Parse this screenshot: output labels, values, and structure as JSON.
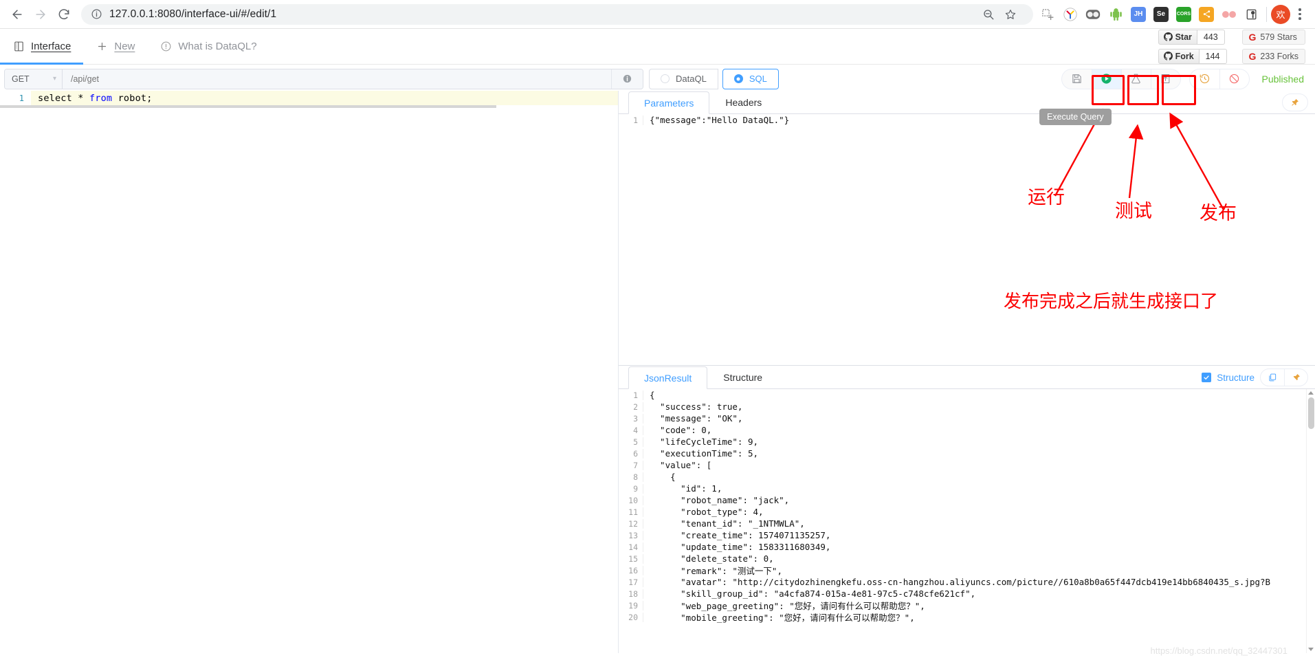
{
  "browser": {
    "url": "127.0.0.1:8080/interface-ui/#/edit/1",
    "back_title": "Back",
    "forward_title": "Forward",
    "reload_title": "Reload",
    "zoom_title": "Zoom",
    "bookmark_title": "Bookmark this page",
    "profile_initial": "欢",
    "extensions": [
      {
        "name": "grid-add-extension",
        "label": "",
        "color": "#9e9e9e"
      },
      {
        "name": "yandex-extension",
        "label": "Y",
        "color": "#ffffff"
      },
      {
        "name": "goggles-extension",
        "label": "",
        "color": "#6b6b6b"
      },
      {
        "name": "android-extension",
        "label": "",
        "color": "#7dc24b"
      },
      {
        "name": "jh-extension",
        "label": "JH",
        "color": "#5b8def"
      },
      {
        "name": "selenium-extension",
        "label": "Se",
        "color": "#2f2f2f"
      },
      {
        "name": "cors-extension",
        "label": "CORS",
        "color": "#2aa32a"
      },
      {
        "name": "share-extension",
        "label": "",
        "color": "#f5a623"
      },
      {
        "name": "glasses-extension",
        "label": "",
        "color": "#f0a0a0"
      },
      {
        "name": "postman-extension",
        "label": "",
        "color": "#ffffff"
      }
    ]
  },
  "app_header": {
    "tabs": [
      {
        "label": "Interface",
        "icon": "interface-icon",
        "active": true
      },
      {
        "label": "New",
        "icon": "plus-icon",
        "active": false
      },
      {
        "label": "What is DataQL?",
        "icon": "info-circle-icon",
        "active": false
      }
    ],
    "github": {
      "star_label": "Star",
      "star_count": "443",
      "fork_label": "Fork",
      "fork_count": "144",
      "gitee_stars": "579 Stars",
      "gitee_forks": "233 Forks"
    }
  },
  "toolbar": {
    "method": "GET",
    "path_placeholder": "/api/get",
    "path_value": "",
    "lang_dataql": "DataQL",
    "lang_sql": "SQL",
    "lang_selected": "SQL",
    "buttons": {
      "save": "save-button",
      "run": "run-button",
      "test": "test-button",
      "publish": "publish-button",
      "history": "history-button",
      "disable": "disable-button"
    },
    "status_badge": "Published"
  },
  "editor": {
    "line_number": "1",
    "code_select": "select",
    "code_star": "*",
    "code_from": "from",
    "code_table": "robot;"
  },
  "params_panel": {
    "tabs": [
      {
        "label": "Parameters",
        "active": true
      },
      {
        "label": "Headers",
        "active": false
      }
    ],
    "line_number": "1",
    "content": "{\"message\":\"Hello DataQL.\"}"
  },
  "result_panel": {
    "tabs": [
      {
        "label": "JsonResult",
        "active": true
      },
      {
        "label": "Structure",
        "active": false
      }
    ],
    "structure_checkbox_label": "Structure",
    "structure_checked": true,
    "lines": [
      {
        "n": "1",
        "t": "{"
      },
      {
        "n": "2",
        "t": "  \"success\": true,"
      },
      {
        "n": "3",
        "t": "  \"message\": \"OK\","
      },
      {
        "n": "4",
        "t": "  \"code\": 0,"
      },
      {
        "n": "5",
        "t": "  \"lifeCycleTime\": 9,"
      },
      {
        "n": "6",
        "t": "  \"executionTime\": 5,"
      },
      {
        "n": "7",
        "t": "  \"value\": ["
      },
      {
        "n": "8",
        "t": "    {"
      },
      {
        "n": "9",
        "t": "      \"id\": 1,"
      },
      {
        "n": "10",
        "t": "      \"robot_name\": \"jack\","
      },
      {
        "n": "11",
        "t": "      \"robot_type\": 4,"
      },
      {
        "n": "12",
        "t": "      \"tenant_id\": \"_1NTMWLA\","
      },
      {
        "n": "13",
        "t": "      \"create_time\": 1574071135257,"
      },
      {
        "n": "14",
        "t": "      \"update_time\": 1583311680349,"
      },
      {
        "n": "15",
        "t": "      \"delete_state\": 0,"
      },
      {
        "n": "16",
        "t": "      \"remark\": \"测试一下\","
      },
      {
        "n": "17",
        "t": "      \"avatar\": \"http://citydozhinengkefu.oss-cn-hangzhou.aliyuncs.com/picture//610a8b0a65f447dcb419e14bb6840435_s.jpg?B"
      },
      {
        "n": "18",
        "t": "      \"skill_group_id\": \"a4cfa874-015a-4e81-97c5-c748cfe621cf\","
      },
      {
        "n": "19",
        "t": "      \"web_page_greeting\": \"您好，请问有什么可以帮助您？\","
      },
      {
        "n": "20",
        "t": "      \"mobile_greeting\": \"您好，请问有什么可以帮助您？\","
      }
    ]
  },
  "annotations": {
    "tooltip": "Execute Query",
    "run": "运行",
    "test": "测试",
    "publish": "发布",
    "note": "发布完成之后就生成接口了",
    "accent_color": "#fb0000"
  },
  "watermark": "https://blog.csdn.net/qq_32447301"
}
